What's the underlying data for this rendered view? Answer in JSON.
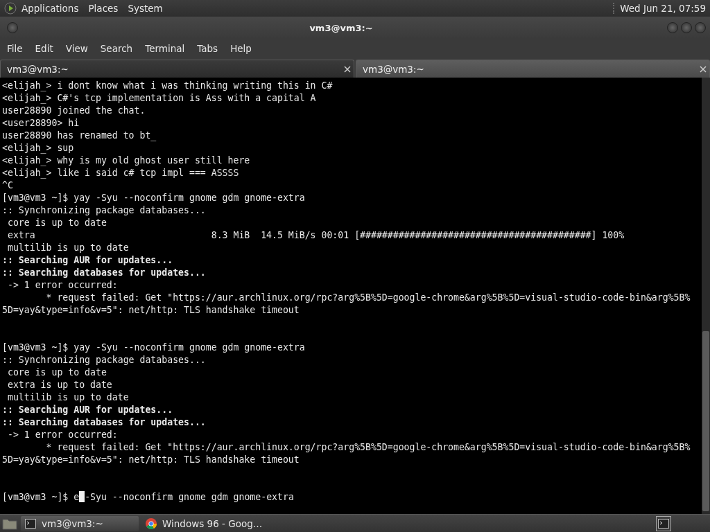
{
  "top_panel": {
    "menus": [
      "Applications",
      "Places",
      "System"
    ],
    "clock": "Wed Jun 21, 07:59"
  },
  "window": {
    "title": "vm3@vm3:~"
  },
  "menu_bar": [
    "File",
    "Edit",
    "View",
    "Search",
    "Terminal",
    "Tabs",
    "Help"
  ],
  "tabs": [
    {
      "label": "vm3@vm3:~",
      "selected": true
    },
    {
      "label": "vm3@vm3:~",
      "selected": false
    }
  ],
  "terminal": {
    "lines": [
      {
        "kind": "normal",
        "text": "<elijah_> i dont know what i was thinking writing this in C#"
      },
      {
        "kind": "normal",
        "text": "<elijah_> C#'s tcp implementation is Ass with a capital A"
      },
      {
        "kind": "normal",
        "text": "user28890 joined the chat."
      },
      {
        "kind": "normal",
        "text": "<user28890> hi"
      },
      {
        "kind": "normal",
        "text": "user28890 has renamed to bt_"
      },
      {
        "kind": "normal",
        "text": "<elijah_> sup"
      },
      {
        "kind": "normal",
        "text": "<elijah_> why is my old ghost user still here"
      },
      {
        "kind": "normal",
        "text": "<elijah_> like i said c# tcp impl === ASSSS"
      },
      {
        "kind": "normal",
        "text": "^C"
      },
      {
        "kind": "normal",
        "text": "[vm3@vm3 ~]$ yay -Syu --noconfirm gnome gdm gnome-extra"
      },
      {
        "kind": "normal",
        "text": ":: Synchronizing package databases..."
      },
      {
        "kind": "normal",
        "text": " core is up to date"
      },
      {
        "kind": "normal",
        "text": " extra                                8.3 MiB  14.5 MiB/s 00:01 [##########################################] 100%"
      },
      {
        "kind": "normal",
        "text": " multilib is up to date"
      },
      {
        "kind": "bold",
        "text": ":: Searching AUR for updates..."
      },
      {
        "kind": "bold",
        "text": ":: Searching databases for updates..."
      },
      {
        "kind": "normal",
        "text": " -> 1 error occurred:"
      },
      {
        "kind": "normal",
        "text": "        * request failed: Get \"https://aur.archlinux.org/rpc?arg%5B%5D=google-chrome&arg%5B%5D=visual-studio-code-bin&arg%5B%"
      },
      {
        "kind": "normal",
        "text": "5D=yay&type=info&v=5\": net/http: TLS handshake timeout"
      },
      {
        "kind": "blank"
      },
      {
        "kind": "blank"
      },
      {
        "kind": "normal",
        "text": "[vm3@vm3 ~]$ yay -Syu --noconfirm gnome gdm gnome-extra"
      },
      {
        "kind": "normal",
        "text": ":: Synchronizing package databases..."
      },
      {
        "kind": "normal",
        "text": " core is up to date"
      },
      {
        "kind": "normal",
        "text": " extra is up to date"
      },
      {
        "kind": "normal",
        "text": " multilib is up to date"
      },
      {
        "kind": "bold",
        "text": ":: Searching AUR for updates..."
      },
      {
        "kind": "bold",
        "text": ":: Searching databases for updates..."
      },
      {
        "kind": "normal",
        "text": " -> 1 error occurred:"
      },
      {
        "kind": "normal",
        "text": "        * request failed: Get \"https://aur.archlinux.org/rpc?arg%5B%5D=google-chrome&arg%5B%5D=visual-studio-code-bin&arg%5B%"
      },
      {
        "kind": "normal",
        "text": "5D=yay&type=info&v=5\": net/http: TLS handshake timeout"
      },
      {
        "kind": "blank"
      },
      {
        "kind": "blank"
      },
      {
        "kind": "cursor",
        "before": "[vm3@vm3 ~]$ e",
        "after": "-Syu --noconfirm gnome gdm gnome-extra"
      }
    ]
  },
  "taskbar": {
    "windows": [
      {
        "label": "vm3@vm3:~",
        "kind": "terminal",
        "selected": true
      },
      {
        "label": "Windows 96 - Goog…",
        "kind": "browser",
        "selected": false
      }
    ]
  }
}
